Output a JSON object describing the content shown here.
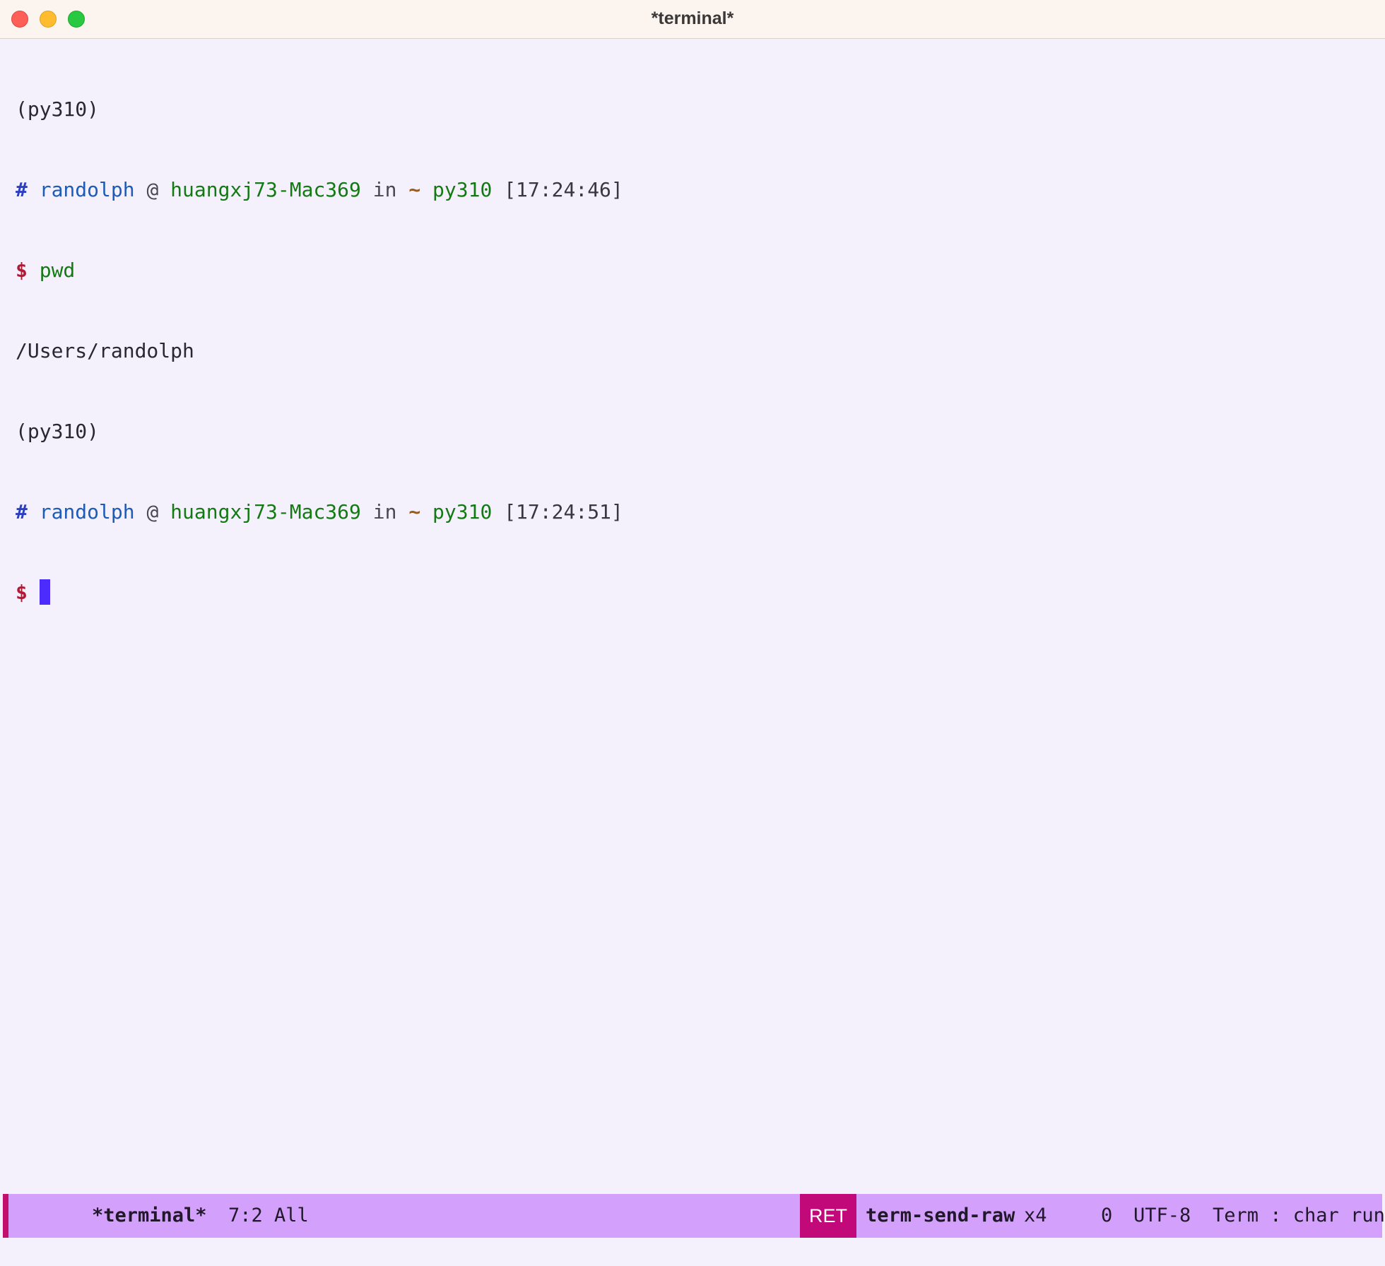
{
  "window": {
    "title": "*terminal*",
    "traffic_lights": {
      "close": "#fe5f57",
      "minimize": "#febc2e",
      "zoom": "#28c840"
    }
  },
  "terminal": {
    "lines": [
      {
        "type": "plain",
        "text": "(py310)"
      },
      {
        "type": "prompt",
        "hash": "#",
        "user": "randolph",
        "at": "@",
        "host": "huangxj73-Mac369",
        "in": "in",
        "dir": "~",
        "env": "py310",
        "time": "[17:24:46]"
      },
      {
        "type": "command",
        "dollar": "$",
        "cmd": "pwd"
      },
      {
        "type": "plain",
        "text": "/Users/randolph"
      },
      {
        "type": "plain",
        "text": "(py310)"
      },
      {
        "type": "prompt",
        "hash": "#",
        "user": "randolph",
        "at": "@",
        "host": "huangxj73-Mac369",
        "in": "in",
        "dir": "~",
        "env": "py310",
        "time": "[17:24:51]"
      },
      {
        "type": "command",
        "dollar": "$",
        "cmd": ""
      }
    ]
  },
  "modeline": {
    "terminal_icon": "terminal-icon",
    "lock_icon": "lock-icon",
    "buffer_name": "*terminal*",
    "position": "7:2 All",
    "key_badge": "RET",
    "command": "term-send-raw",
    "repeat": "x4",
    "mail_icon": "envelope-icon",
    "mail_count": "0",
    "encoding": "UTF-8",
    "mode": "Term : char run",
    "colors": {
      "background": "#d3a1fb",
      "accent": "#c20e6d",
      "badge": "#c1097a"
    }
  }
}
